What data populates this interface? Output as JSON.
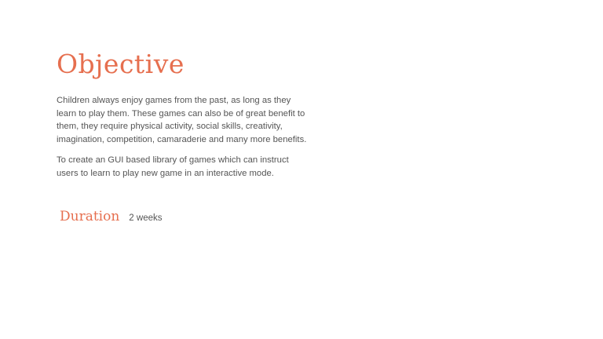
{
  "slide": {
    "title": "Objective",
    "paragraph1": [
      "Children always enjoy games from the past, as long as they",
      "learn to play them. These games can also be of great benefit to",
      "them, they require physical activity, social skills, creativity,",
      "imagination, competition, camaraderie and many more benefits."
    ],
    "paragraph2": [
      "To create an GUI based library of games which can instruct",
      "users to learn to play new game in an interactive mode."
    ],
    "duration_label": "Duration",
    "duration_value": "2 weeks"
  },
  "colors": {
    "accent": "#e66f4f",
    "text": "#555555",
    "background": "#ffffff"
  }
}
